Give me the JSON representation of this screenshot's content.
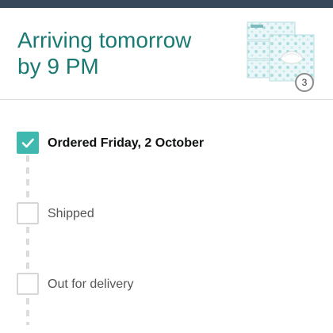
{
  "header": {
    "arrival_line1": "Arriving tomorrow",
    "arrival_line2": "by 9 PM"
  },
  "product": {
    "quantity": "3",
    "image": "tissue-box-pack"
  },
  "steps": [
    {
      "label": "Ordered Friday, 2 October",
      "checked": true
    },
    {
      "label": "Shipped",
      "checked": false
    },
    {
      "label": "Out for delivery",
      "checked": false
    }
  ],
  "colors": {
    "accent": "#1a7a73",
    "check": "#3fb9b0",
    "topbar": "#37475a"
  }
}
